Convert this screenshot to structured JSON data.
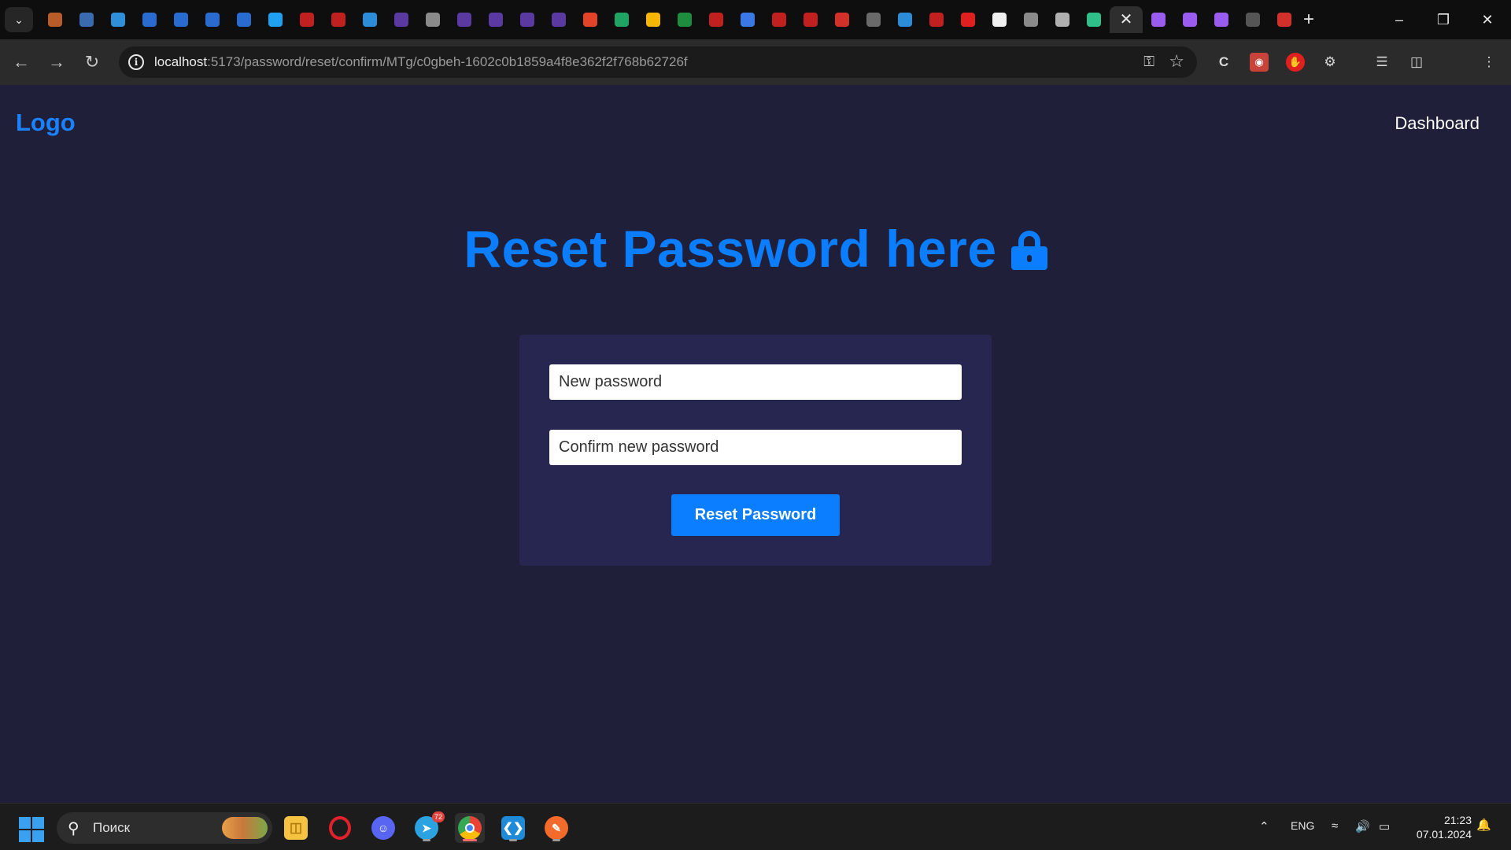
{
  "browser": {
    "tabs": [
      {
        "icon": "photos-icon",
        "color": "#b85c2a"
      },
      {
        "icon": "maps-icon",
        "color": "#3a6ab0"
      },
      {
        "icon": "chat-icon",
        "color": "#2f8fd8"
      },
      {
        "icon": "vk-icon",
        "color": "#2a6bd0"
      },
      {
        "icon": "vk-icon",
        "color": "#2a6bd0"
      },
      {
        "icon": "vk-icon",
        "color": "#2a6bd0"
      },
      {
        "icon": "vk-icon",
        "color": "#2a6bd0"
      },
      {
        "icon": "messenger-icon",
        "color": "#1fa0f0"
      },
      {
        "icon": "youtube-icon",
        "color": "#c0201f"
      },
      {
        "icon": "youtube-icon",
        "color": "#c0201f"
      },
      {
        "icon": "swirl-icon",
        "color": "#2c8cd8"
      },
      {
        "icon": "graphql-icon",
        "color": "#5a3aa0"
      },
      {
        "icon": "globe-icon",
        "color": "#8a8a8a"
      },
      {
        "icon": "graphql-icon",
        "color": "#5a3aa0"
      },
      {
        "icon": "graphql-icon",
        "color": "#5a3aa0"
      },
      {
        "icon": "graphql-icon",
        "color": "#5a3aa0"
      },
      {
        "icon": "graphql-icon",
        "color": "#5a3aa0"
      },
      {
        "icon": "gitlab-icon",
        "color": "#e24329"
      },
      {
        "icon": "drive-icon",
        "color": "#1fa463"
      },
      {
        "icon": "drive-icon",
        "color": "#f6b704"
      },
      {
        "icon": "sheets-icon",
        "color": "#1e8e3e"
      },
      {
        "icon": "youtube-icon",
        "color": "#c0201f"
      },
      {
        "icon": "docs-icon",
        "color": "#3b78e7"
      },
      {
        "icon": "youtube-icon",
        "color": "#c0201f"
      },
      {
        "icon": "youtube-icon",
        "color": "#c0201f"
      },
      {
        "icon": "acrobat-icon",
        "color": "#d4302a"
      },
      {
        "icon": "book-icon",
        "color": "#6a6a6a"
      },
      {
        "icon": "swirl-icon",
        "color": "#2c8cd8"
      },
      {
        "icon": "youtube-icon",
        "color": "#c0201f"
      },
      {
        "icon": "youtube-icon",
        "color": "#e0201f"
      },
      {
        "icon": "github-icon",
        "color": "#f0f0f0"
      },
      {
        "icon": "globe-icon",
        "color": "#8a8a8a"
      },
      {
        "icon": "globe-icon",
        "color": "#b0b0b0"
      },
      {
        "icon": "envelope-icon",
        "color": "#2fc08a"
      },
      {
        "icon": "close-icon",
        "color": "#e8e8e8",
        "active": true
      },
      {
        "icon": "vite-icon",
        "color": "#9a5cf0"
      },
      {
        "icon": "vite-icon",
        "color": "#9a5cf0"
      },
      {
        "icon": "vite-icon",
        "color": "#9a5cf0"
      },
      {
        "icon": "github-icon",
        "color": "#555555"
      },
      {
        "icon": "acrobat-icon",
        "color": "#d4302a"
      }
    ],
    "url_host": "localhost",
    "url_rest": ":5173/password/reset/confirm/MTg/c0gbeh-1602c0b1859a4f8e362f2f768b62726f"
  },
  "page": {
    "logo": "Logo",
    "nav_dashboard": "Dashboard",
    "title": "Reset Password here",
    "new_password_placeholder": "New password",
    "confirm_password_placeholder": "Confirm new password",
    "submit_label": "Reset Password",
    "accent_color": "#0b7dff",
    "background_color": "#1f1f3a",
    "card_color": "#262650"
  },
  "taskbar": {
    "search_label": "Поиск",
    "telegram_badge": "72",
    "language": "ENG",
    "time": "21:23",
    "date": "07.01.2024"
  }
}
